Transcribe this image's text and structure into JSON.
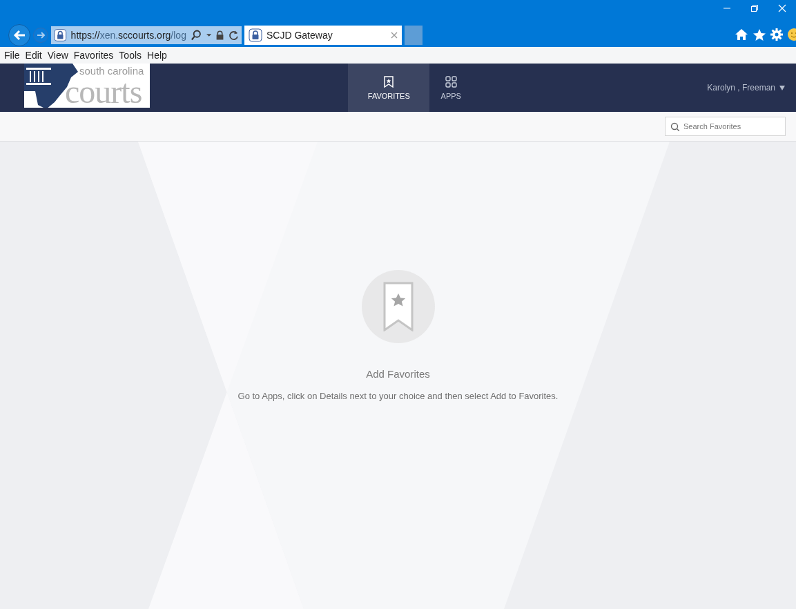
{
  "browser": {
    "url": {
      "scheme": "https://",
      "subdomain": "xen.",
      "domain": "sccourts.org",
      "path": "/log"
    },
    "tabs": [
      {
        "title": "SCJD Gateway",
        "selected": true
      }
    ],
    "menu": [
      "File",
      "Edit",
      "View",
      "Favorites",
      "Tools",
      "Help"
    ]
  },
  "header": {
    "logo": {
      "line_1": "south carolina",
      "line_2": "courts"
    },
    "nav": [
      {
        "label": "FAVORITES",
        "kind": "bookmark",
        "selected": true
      },
      {
        "label": "APPS",
        "kind": "grid",
        "selected": false
      }
    ],
    "user": "Karolyn , Freeman"
  },
  "search": {
    "placeholder": "Search Favorites"
  },
  "empty_state": {
    "title": "Add Favorites",
    "message": "Go to Apps, click on Details next to your choice and then select Add to Favorites."
  }
}
